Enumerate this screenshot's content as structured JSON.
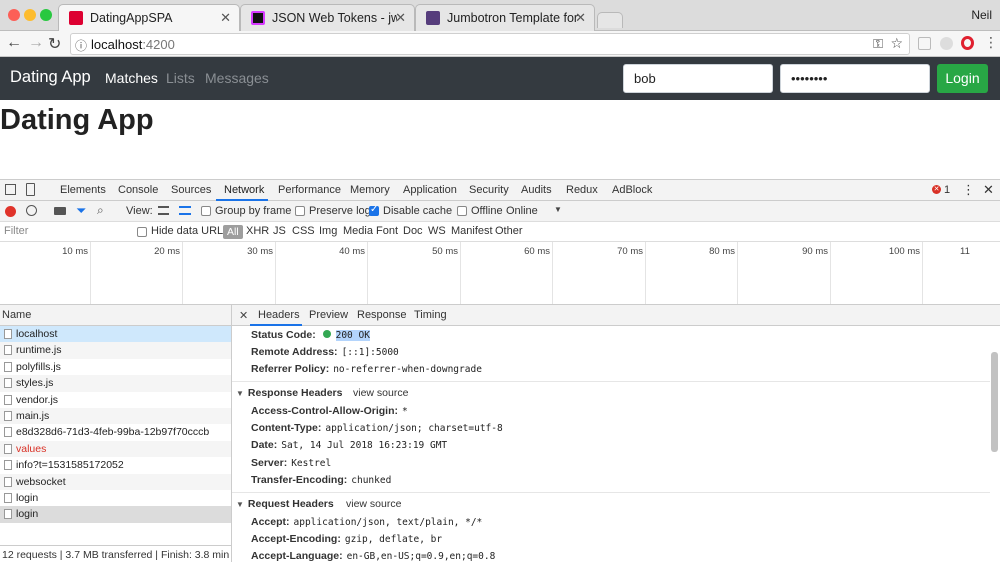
{
  "browser": {
    "tabs": [
      {
        "title": "DatingAppSPA",
        "icon": "angular-icon",
        "active": true
      },
      {
        "title": "JSON Web Tokens - jwt.io",
        "icon": "jwt-icon",
        "active": false
      },
      {
        "title": "Jumbotron Template for Boots",
        "icon": "bootstrap-icon",
        "active": false
      }
    ],
    "user": "Neil",
    "url_host": "localhost",
    "url_port": ":4200"
  },
  "app": {
    "brand": "Dating App",
    "nav": [
      "Matches",
      "Lists",
      "Messages"
    ],
    "username_value": "bob",
    "password_value": "••••••••",
    "login_label": "Login",
    "heading": "Dating App",
    "colors": {
      "navbar": "#343a40",
      "login": "#28a745"
    }
  },
  "devtools": {
    "tabs": [
      "Elements",
      "Console",
      "Sources",
      "Network",
      "Performance",
      "Memory",
      "Application",
      "Security",
      "Audits",
      "Redux",
      "AdBlock"
    ],
    "selected_tab": "Network",
    "error_count": "1",
    "toolbar": {
      "view_label": "View:",
      "group_by_frame": "Group by frame",
      "preserve_log": "Preserve log",
      "disable_cache": "Disable cache",
      "offline": "Offline",
      "throttle": "Online"
    },
    "filter": {
      "placeholder": "Filter",
      "hide_data_urls": "Hide data URLs",
      "types": [
        "All",
        "XHR",
        "JS",
        "CSS",
        "Img",
        "Media",
        "Font",
        "Doc",
        "WS",
        "Manifest",
        "Other"
      ]
    },
    "timeline_ticks": [
      "10 ms",
      "20 ms",
      "30 ms",
      "40 ms",
      "50 ms",
      "60 ms",
      "70 ms",
      "80 ms",
      "90 ms",
      "100 ms",
      "11"
    ],
    "name_header": "Name",
    "requests": [
      {
        "name": "localhost",
        "state": "selected"
      },
      {
        "name": "runtime.js",
        "state": ""
      },
      {
        "name": "polyfills.js",
        "state": ""
      },
      {
        "name": "styles.js",
        "state": ""
      },
      {
        "name": "vendor.js",
        "state": ""
      },
      {
        "name": "main.js",
        "state": ""
      },
      {
        "name": "e8d328d6-71d3-4feb-99ba-12b97f70cccb",
        "state": ""
      },
      {
        "name": "values",
        "state": "error"
      },
      {
        "name": "info?t=1531585172052",
        "state": ""
      },
      {
        "name": "websocket",
        "state": ""
      },
      {
        "name": "login",
        "state": ""
      },
      {
        "name": "login",
        "state": "active"
      }
    ],
    "summary": "12 requests | 3.7 MB transferred | Finish: 3.8 min",
    "detail_tabs": [
      "Headers",
      "Preview",
      "Response",
      "Timing"
    ],
    "general": [
      {
        "key": "Status Code:",
        "value": "200 OK"
      },
      {
        "key": "Remote Address:",
        "value": "[::1]:5000"
      },
      {
        "key": "Referrer Policy:",
        "value": "no-referrer-when-downgrade"
      }
    ],
    "response_headers_title": "Response Headers",
    "request_headers_title": "Request Headers",
    "view_source": "view source",
    "response_headers": [
      {
        "key": "Access-Control-Allow-Origin:",
        "value": "*"
      },
      {
        "key": "Content-Type:",
        "value": "application/json; charset=utf-8"
      },
      {
        "key": "Date:",
        "value": "Sat, 14 Jul 2018 16:23:19 GMT"
      },
      {
        "key": "Server:",
        "value": "Kestrel"
      },
      {
        "key": "Transfer-Encoding:",
        "value": "chunked"
      }
    ],
    "request_headers": [
      {
        "key": "Accept:",
        "value": "application/json, text/plain, */*"
      },
      {
        "key": "Accept-Encoding:",
        "value": "gzip, deflate, br"
      },
      {
        "key": "Accept-Language:",
        "value": "en-GB,en-US;q=0.9,en;q=0.8"
      }
    ]
  }
}
